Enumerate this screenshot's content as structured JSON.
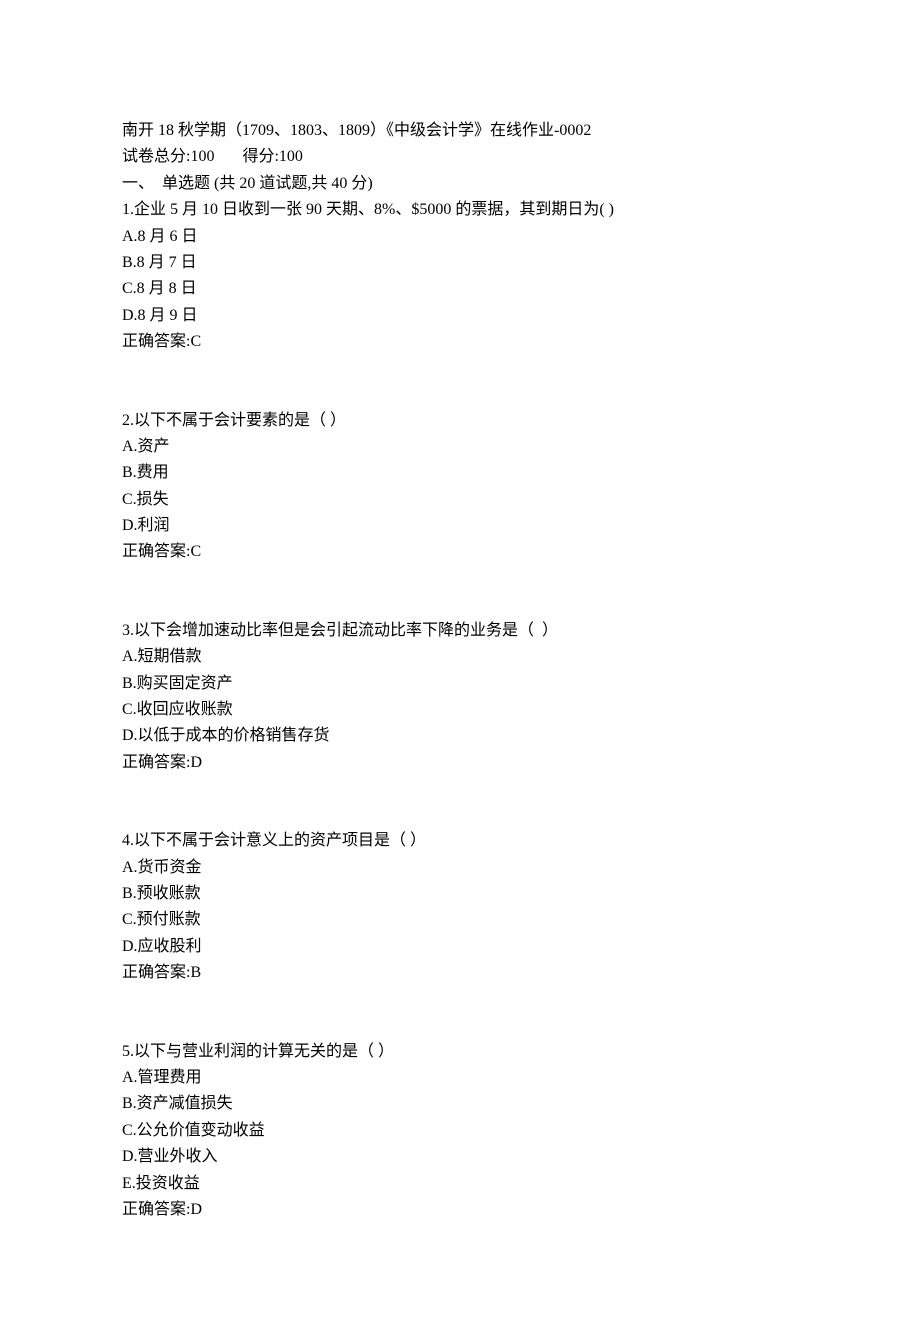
{
  "header": {
    "title": "南开 18 秋学期（1709、1803、1809）《中级会计学》在线作业-0002",
    "score_line": "试卷总分:100       得分:100",
    "section_heading": "一、  单选题 (共 20 道试题,共 40 分)"
  },
  "questions": [
    {
      "stem": "1.企业 5 月 10 日收到一张 90 天期、8%、$5000 的票据，其到期日为( )",
      "options": [
        "A.8 月 6 日",
        "B.8 月 7 日",
        "C.8 月 8 日",
        "D.8 月 9 日"
      ],
      "answer": "正确答案:C"
    },
    {
      "stem": "2.以下不属于会计要素的是（ ）",
      "options": [
        "A.资产",
        "B.费用",
        "C.损失",
        "D.利润"
      ],
      "answer": "正确答案:C"
    },
    {
      "stem": "3.以下会增加速动比率但是会引起流动比率下降的业务是（  ）",
      "options": [
        "A.短期借款",
        "B.购买固定资产",
        "C.收回应收账款",
        "D.以低于成本的价格销售存货"
      ],
      "answer": "正确答案:D"
    },
    {
      "stem": "4.以下不属于会计意义上的资产项目是（ ）",
      "options": [
        "A.货币资金",
        "B.预收账款",
        "C.预付账款",
        "D.应收股利"
      ],
      "answer": "正确答案:B"
    },
    {
      "stem": "5.以下与营业利润的计算无关的是（ ）",
      "options": [
        "A.管理费用",
        "B.资产减值损失",
        "C.公允价值变动收益",
        "D.营业外收入",
        "E.投资收益"
      ],
      "answer": "正确答案:D"
    }
  ]
}
